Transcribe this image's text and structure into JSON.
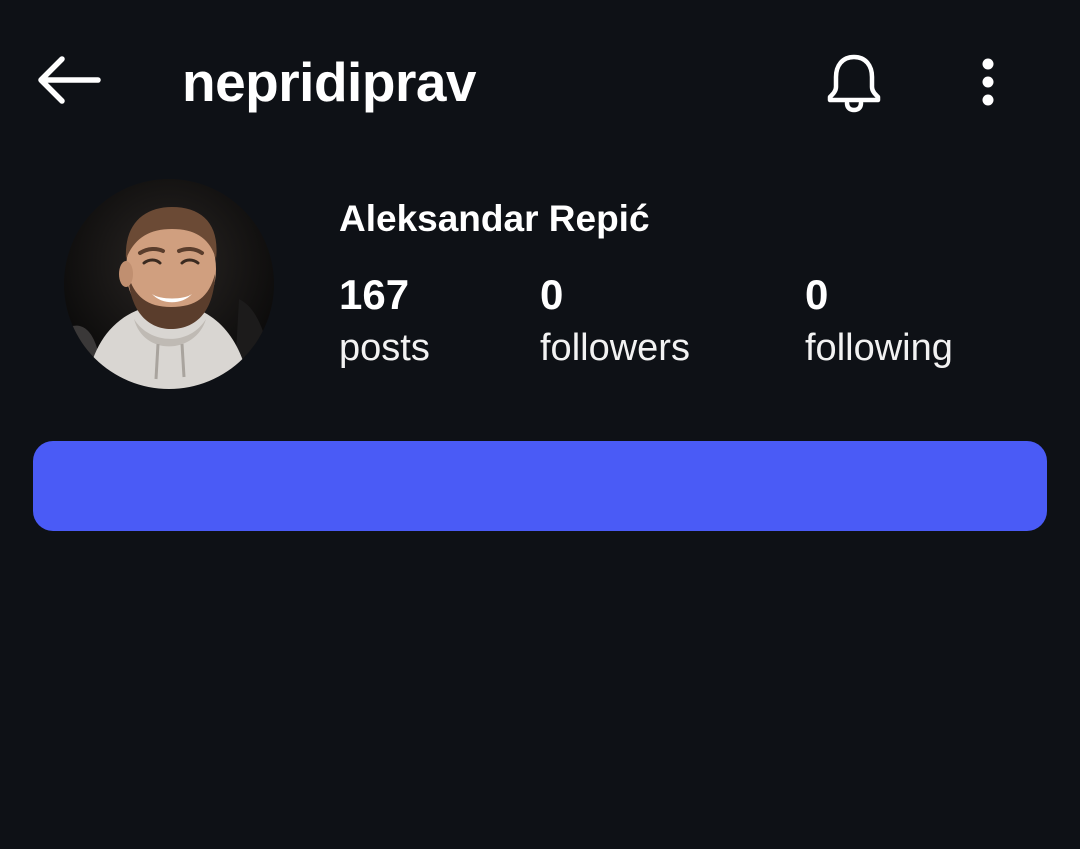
{
  "header": {
    "username": "nepridiprav",
    "back_icon": "arrow-left-icon",
    "notifications_icon": "bell-icon",
    "more_icon": "more-vertical-icon"
  },
  "profile": {
    "display_name": "Aleksandar Repić",
    "avatar_icon": "profile-photo",
    "stats": {
      "posts": {
        "value": "167",
        "label": "posts"
      },
      "followers": {
        "value": "0",
        "label": "followers"
      },
      "following": {
        "value": "0",
        "label": "following"
      }
    }
  },
  "action_button": {
    "label": "",
    "color": "#4a5bf6"
  },
  "theme": {
    "background": "#0e1116",
    "text": "#ffffff"
  }
}
